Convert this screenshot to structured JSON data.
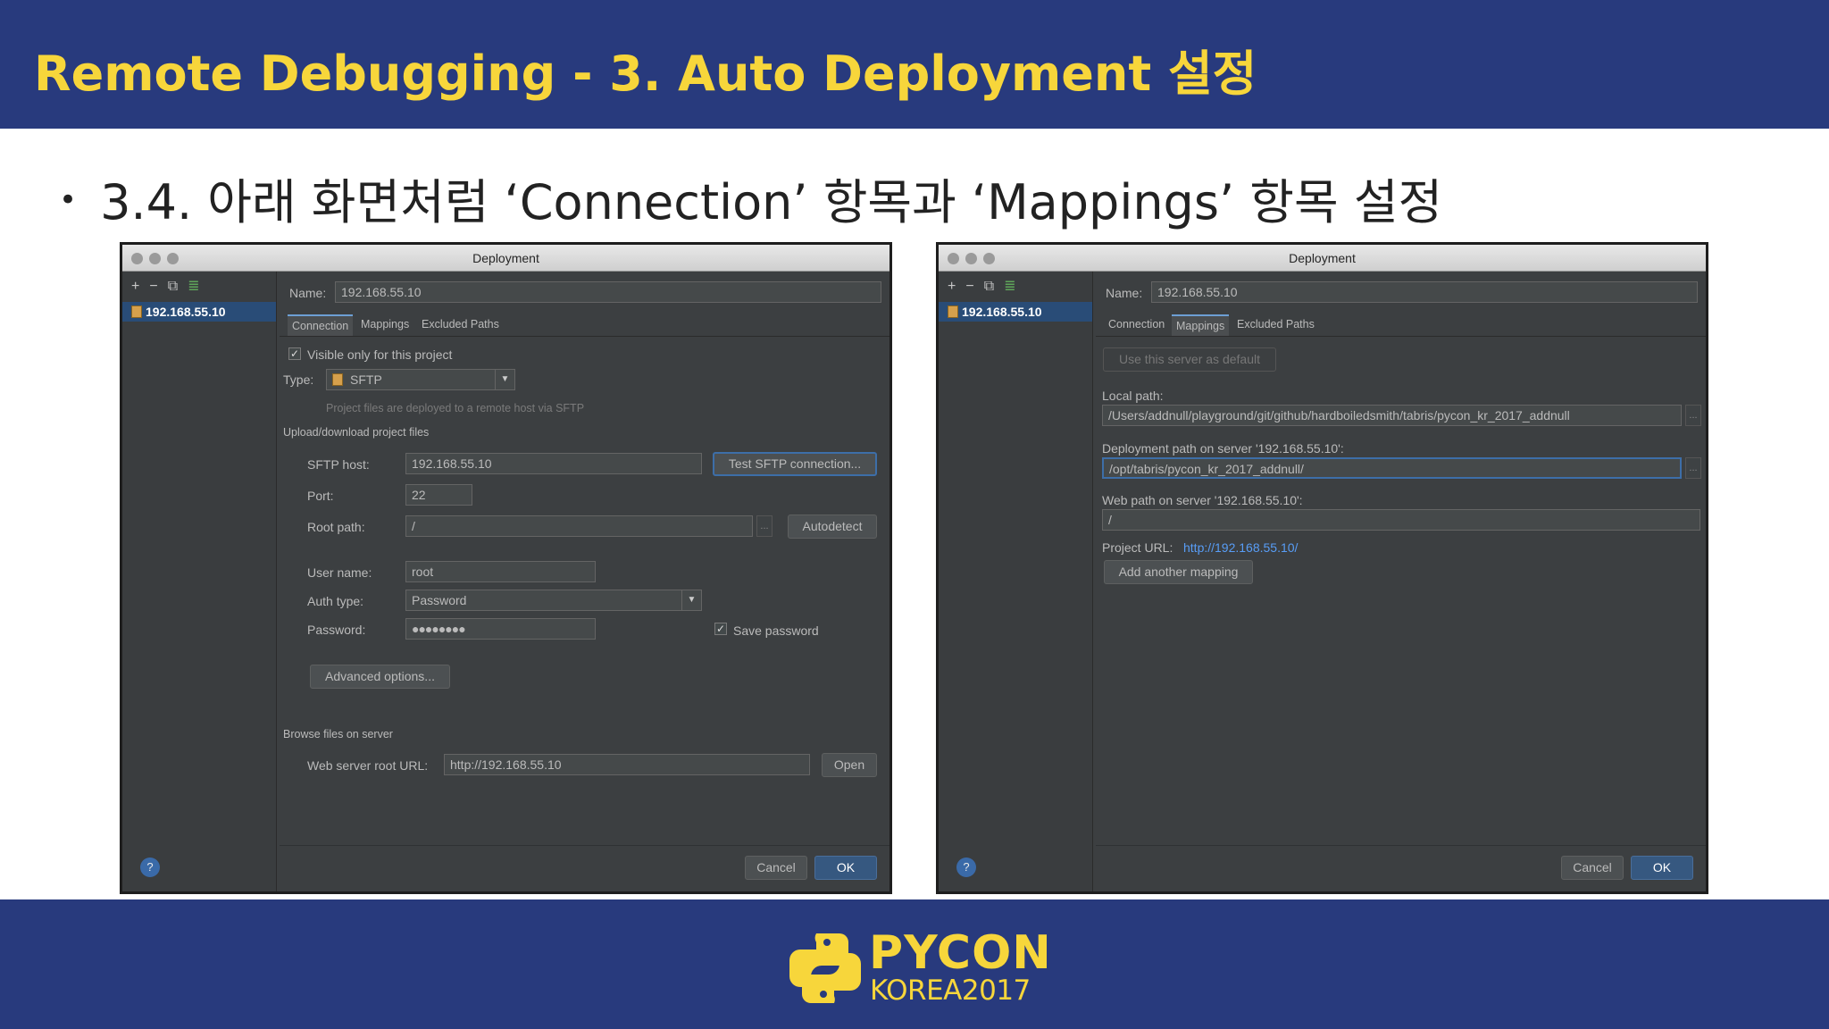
{
  "slide": {
    "title": "Remote Debugging - 3. Auto Deployment 설정",
    "bullet": "3.4. 아래 화면처럼 ‘Connection’ 항목과 ‘Mappings’ 항목 설정",
    "footer_logo": {
      "name": "PYCON",
      "subtitle": "KOREA2017"
    },
    "colors": {
      "header_bg": "#283a7d",
      "title": "#f7d63b",
      "footer_bg": "#283a7d"
    }
  },
  "left_dialog": {
    "title": "Deployment",
    "toolbar_icons": [
      "plus-icon",
      "minus-icon",
      "copy-icon",
      "default-server-icon"
    ],
    "server_entry": "192.168.55.10",
    "name_label": "Name:",
    "name_value": "192.168.55.10",
    "tabs": [
      "Connection",
      "Mappings",
      "Excluded Paths"
    ],
    "active_tab": "Connection",
    "visible_only_label": "Visible only for this project",
    "type_label": "Type:",
    "type_value": "SFTP",
    "type_hint": "Project files are deployed to a remote host via SFTP",
    "upload_section": "Upload/download project files",
    "sftp_host_label": "SFTP host:",
    "sftp_host_value": "192.168.55.10",
    "test_button": "Test SFTP connection...",
    "port_label": "Port:",
    "port_value": "22",
    "root_path_label": "Root path:",
    "root_path_value": "/",
    "ellipsis": "...",
    "autodetect_button": "Autodetect",
    "user_name_label": "User name:",
    "user_name_value": "root",
    "auth_type_label": "Auth type:",
    "auth_type_value": "Password",
    "password_label": "Password:",
    "password_value": "●●●●●●●●",
    "save_password_label": "Save password",
    "advanced_button": "Advanced options...",
    "browse_section": "Browse files on server",
    "web_root_label": "Web server root URL:",
    "web_root_value": "http://192.168.55.10",
    "open_button": "Open",
    "help": "?",
    "cancel_button": "Cancel",
    "ok_button": "OK"
  },
  "right_dialog": {
    "title": "Deployment",
    "toolbar_icons": [
      "plus-icon",
      "minus-icon",
      "copy-icon",
      "default-server-icon"
    ],
    "server_entry": "192.168.55.10",
    "name_label": "Name:",
    "name_value": "192.168.55.10",
    "tabs": [
      "Connection",
      "Mappings",
      "Excluded Paths"
    ],
    "active_tab": "Mappings",
    "default_button": "Use this server as default",
    "local_path_label": "Local path:",
    "local_path_value": "/Users/addnull/playground/git/github/hardboiledsmith/tabris/pycon_kr_2017_addnull",
    "deploy_path_label": "Deployment path on server '192.168.55.10':",
    "deploy_path_value": "/opt/tabris/pycon_kr_2017_addnull/",
    "web_path_label": "Web path on server '192.168.55.10':",
    "web_path_value": "/",
    "ellipsis": "...",
    "project_url_label": "Project URL:",
    "project_url_value": "http://192.168.55.10/",
    "add_mapping_button": "Add another mapping",
    "help": "?",
    "cancel_button": "Cancel",
    "ok_button": "OK"
  }
}
